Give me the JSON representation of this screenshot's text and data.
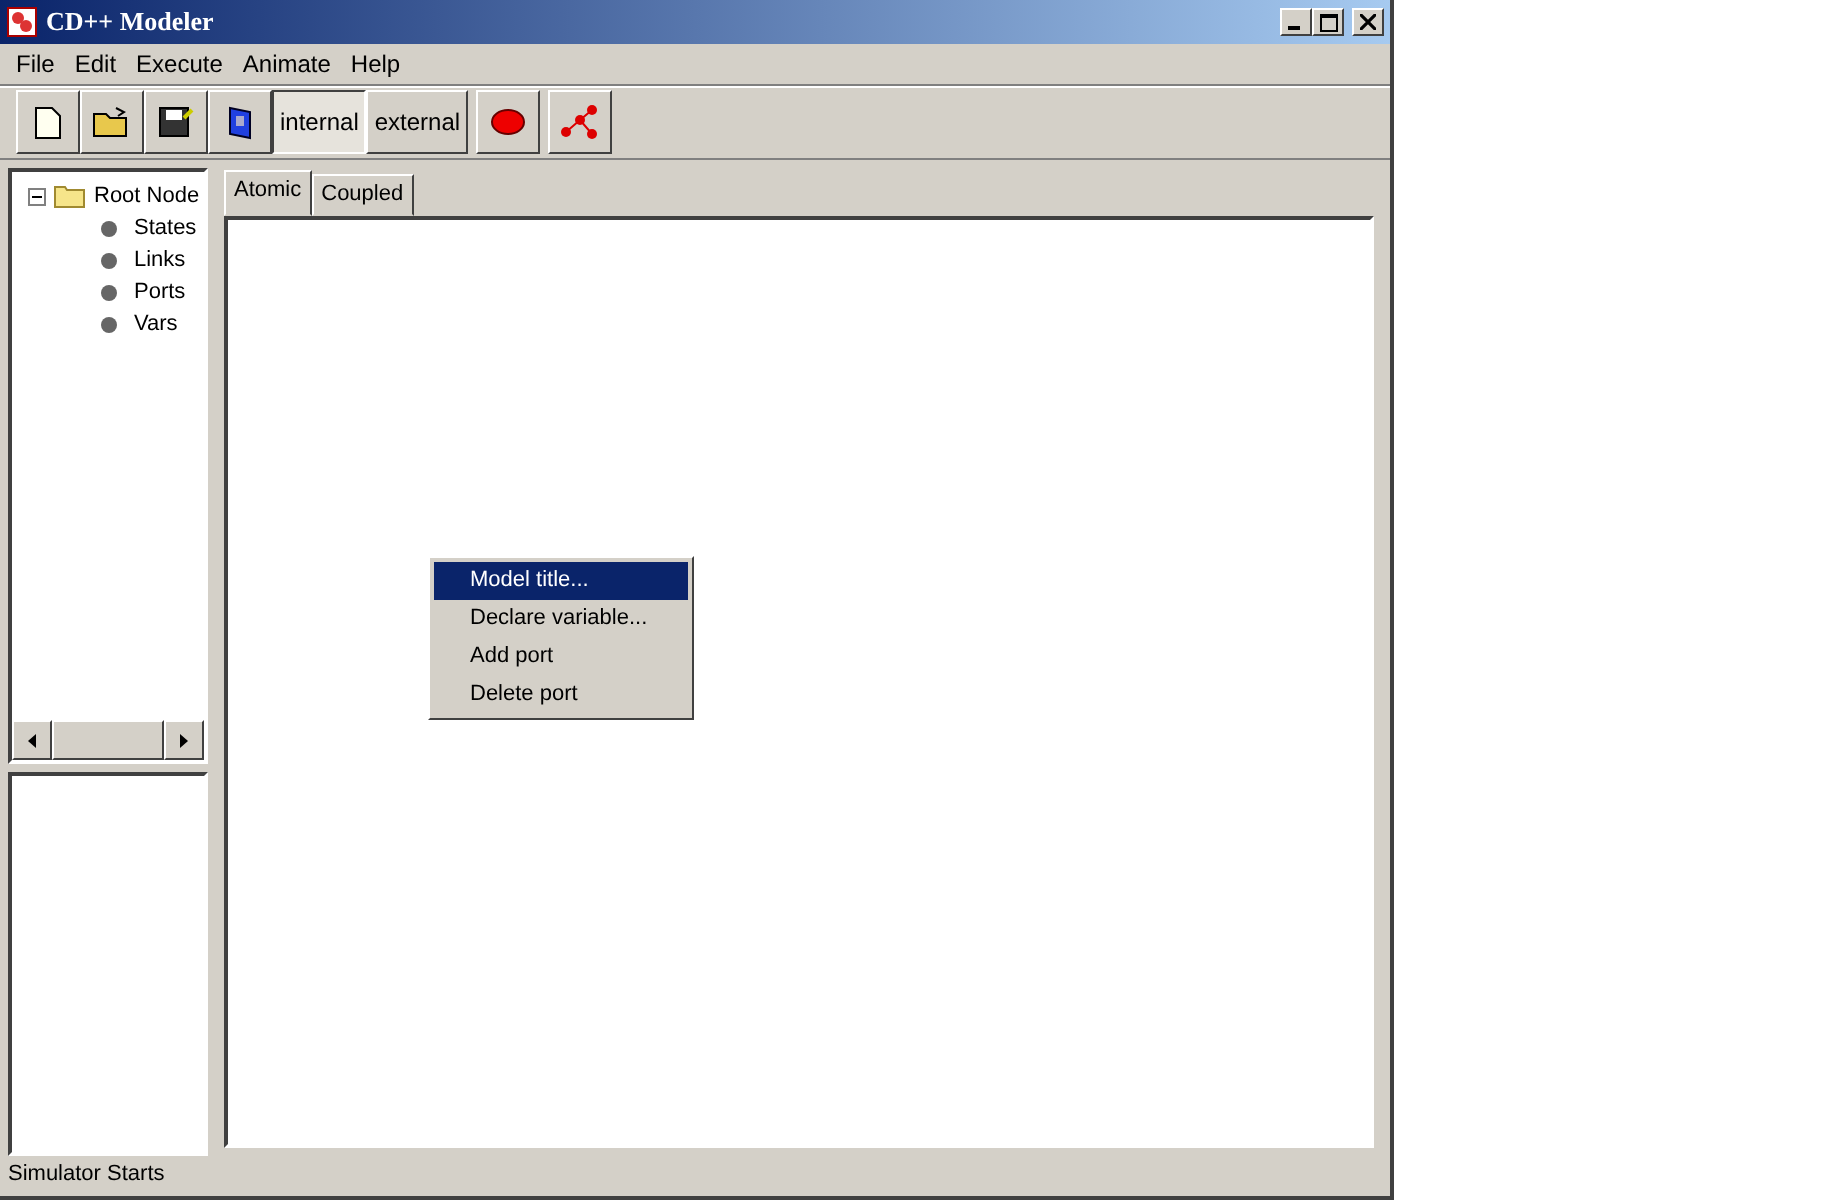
{
  "window": {
    "title": "CD++ Modeler"
  },
  "menu_bar": [
    "File",
    "Edit",
    "Execute",
    "Animate",
    "Help"
  ],
  "toolbar": [
    {
      "kind": "new"
    },
    {
      "kind": "open"
    },
    {
      "kind": "save"
    },
    {
      "kind": "book"
    },
    {
      "kind": "text",
      "label": "internal",
      "selected": true
    },
    {
      "kind": "text",
      "label": "external",
      "selected": false
    },
    {
      "kind": "stop"
    },
    {
      "kind": "graph"
    }
  ],
  "tree": {
    "label": "Root Node",
    "expanded": true,
    "children": [
      {
        "label": "States"
      },
      {
        "label": "Links"
      },
      {
        "label": "Ports"
      },
      {
        "label": "Vars"
      }
    ]
  },
  "tabs": [
    {
      "label": "Atomic",
      "selected": true
    },
    {
      "label": "Coupled",
      "selected": false
    }
  ],
  "context_menu": [
    {
      "label": "Model title...",
      "selected": true
    },
    {
      "label": "Declare variable...",
      "selected": false
    },
    {
      "label": "Add port",
      "selected": false
    },
    {
      "label": "Delete port",
      "selected": false
    }
  ],
  "status_bar": "Simulator Starts"
}
